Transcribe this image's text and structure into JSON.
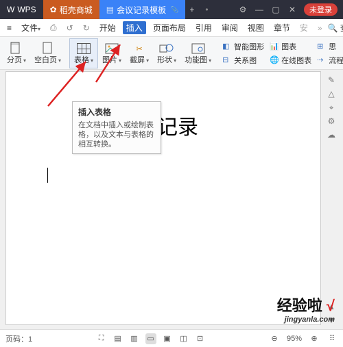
{
  "titlebar": {
    "app": "WPS",
    "tab_store": "稻壳商城",
    "tab_doc": "会议记录模板",
    "login": "未登录"
  },
  "menubar": {
    "menu_icon": "≡",
    "file": "文件",
    "start": "开始",
    "insert": "插入",
    "layout": "页面布局",
    "cite": "引用",
    "review": "审阅",
    "view": "视图",
    "chapter": "章节",
    "safe": "安",
    "search": "查找"
  },
  "ribbon": {
    "cover": "分页",
    "blank": "空白页",
    "table": "表格",
    "pic": "图片",
    "screenshot": "截屏",
    "shapes": "形状",
    "funcpic": "功能图",
    "smart": "智能图形",
    "relate": "关系图",
    "chart": "图表",
    "online": "在线图表",
    "flow": "流程"
  },
  "tooltip": {
    "title": "插入表格",
    "body": "在文档中插入或绘制表格，以及文本与表格的相互转换。"
  },
  "doc": {
    "title": "会议记录"
  },
  "status": {
    "page": "页码：1",
    "zoom": "95%"
  },
  "watermark": {
    "line1a": "经验啦",
    "line1b": "√",
    "line2": "jingyanla.com"
  }
}
